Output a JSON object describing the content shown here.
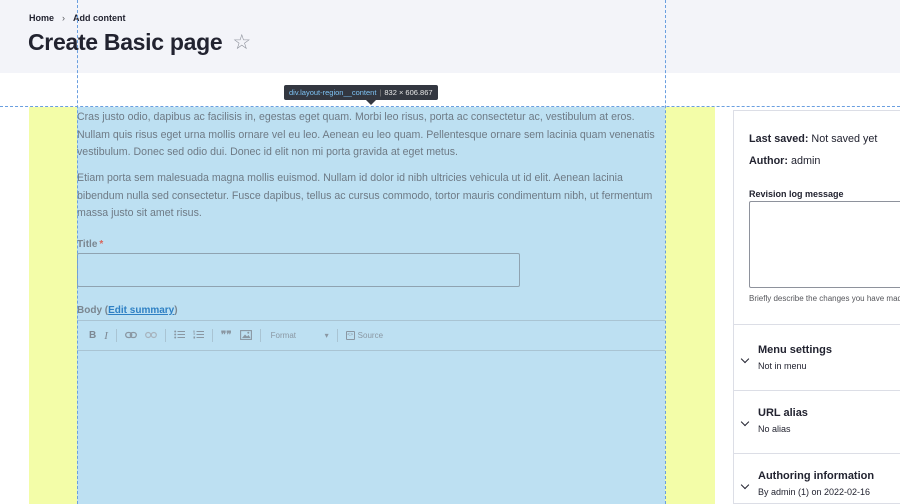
{
  "breadcrumb": {
    "home": "Home",
    "separator": "›",
    "current": "Add content"
  },
  "page": {
    "title": "Create Basic page",
    "favorite_icon": "☆"
  },
  "devtools": {
    "selector": "div.layout-region__content",
    "separator": "|",
    "dimensions": "832 × 606.867"
  },
  "content": {
    "paragraph1": "Cras justo odio, dapibus ac facilisis in, egestas eget quam. Morbi leo risus, porta ac consectetur ac, vestibulum at eros. Nullam quis risus eget urna mollis ornare vel eu leo. Aenean eu leo quam. Pellentesque ornare sem lacinia quam venenatis vestibulum. Donec sed odio dui. Donec id elit non mi porta gravida at eget metus.",
    "paragraph2": "Etiam porta sem malesuada magna mollis euismod. Nullam id dolor id nibh ultricies vehicula ut id elit. Aenean lacinia bibendum nulla sed consectetur. Fusce dapibus, tellus ac cursus commodo, tortor mauris condimentum nibh, ut fermentum massa justo sit amet risus."
  },
  "form": {
    "title_label": "Title",
    "required_marker": "*",
    "title_value": "",
    "body_label": "Body",
    "edit_summary_label": "Edit summary",
    "toolbar": {
      "bold": "B",
      "italic": "I",
      "link_icon": "link-icon",
      "unlink_icon": "unlink-icon",
      "bulleted_list_icon": "bulleted-list-icon",
      "numbered_list_icon": "numbered-list-icon",
      "blockquote": "❞❞",
      "image_icon": "image-icon",
      "format_label": "Format",
      "format_caret": "▾",
      "source_label": "Source"
    }
  },
  "sidebar": {
    "last_saved_label": "Last saved:",
    "last_saved_value": "Not saved yet",
    "author_label": "Author:",
    "author_value": "admin",
    "revision_log_label": "Revision log message",
    "revision_log_value": "",
    "revision_log_description": "Briefly describe the changes you have made.",
    "sections": [
      {
        "title": "Menu settings",
        "summary": "Not in menu"
      },
      {
        "title": "URL alias",
        "summary": "No alias"
      },
      {
        "title": "Authoring information",
        "summary": "By admin (1) on 2022-02-16"
      }
    ]
  },
  "colors": {
    "header_bg": "#f3f4f9",
    "content_highlight": "#bde0f2",
    "margin_highlight": "#f3fda8",
    "link": "#2e80c4",
    "required": "#d9645a"
  }
}
